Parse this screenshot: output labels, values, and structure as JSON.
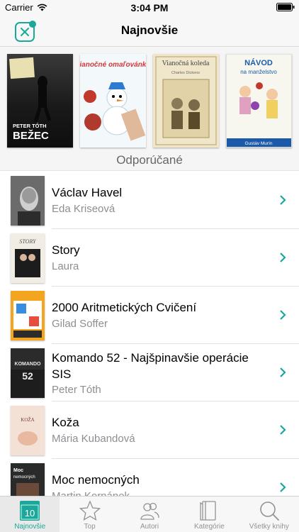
{
  "status": {
    "carrier": "Carrier",
    "time": "3:04 PM"
  },
  "nav": {
    "title": "Najnovšie"
  },
  "covers": [
    {
      "author": "PETER TÓTH",
      "title": "BEŽEC"
    },
    {
      "title": "Vianočné omaľovánky"
    },
    {
      "title": "Vianočná koleda",
      "author": "Charles Dickens"
    },
    {
      "title": "NÁVOD na manželstvo",
      "author": "Gustáv Murín"
    }
  ],
  "section": {
    "title": "Odporúčané"
  },
  "books": [
    {
      "title": "Václav Havel",
      "author": "Eda Kriseová"
    },
    {
      "title": "Story",
      "author": "Laura"
    },
    {
      "title": "2000 Aritmetických Cvičení",
      "author": "Gilad Soffer"
    },
    {
      "title": "Komando 52 - Najšpinavšie operácie SIS",
      "author": "Peter Tóth"
    },
    {
      "title": "Koža",
      "author": "Mária Kubandová"
    },
    {
      "title": "Moc nemocných",
      "author": "Martin Kornánek"
    }
  ],
  "tabs": [
    {
      "label": "Najnovšie",
      "icon": "calendar-icon",
      "badge": "10"
    },
    {
      "label": "Top",
      "icon": "star-icon"
    },
    {
      "label": "Autori",
      "icon": "people-icon"
    },
    {
      "label": "Kategórie",
      "icon": "books-icon"
    },
    {
      "label": "Všetky knihy",
      "icon": "search-icon"
    }
  ],
  "colors": {
    "accent": "#1aa89a",
    "chevron": "#1aa89a"
  }
}
